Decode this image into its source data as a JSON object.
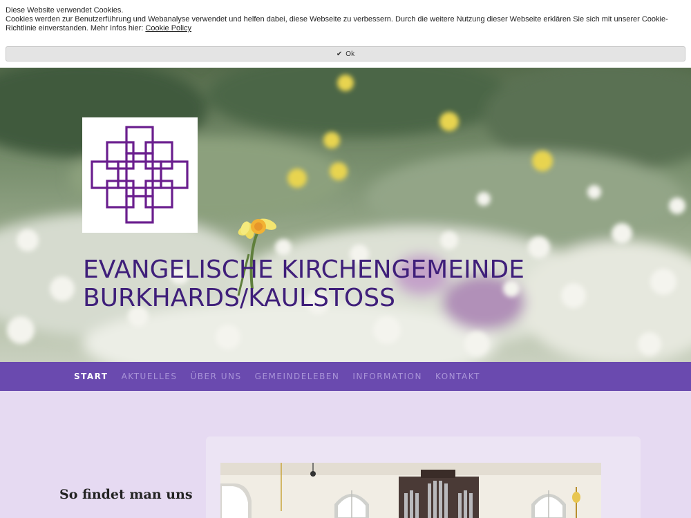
{
  "cookie": {
    "heading": "Diese Website verwendet Cookies.",
    "body": "Cookies werden zur Benutzerführung und Webanalyse verwendet und helfen dabei, diese Webseite zu verbessern. Durch die weitere Nutzung dieser Webseite erklären Sie sich mit unserer Cookie-Richtlinie einverstanden. Mehr Infos hier: ",
    "link_label": "Cookie Policy",
    "ok_label": "Ok",
    "ok_icon": "check-icon"
  },
  "header": {
    "title_line1": "Evangelische Kirchengemeinde",
    "title_line2": "Burkhards/Kaulstoss",
    "logo_icon": "cross-logo-icon",
    "logo_color": "#6a1e8e"
  },
  "nav": {
    "items": [
      {
        "label": "Start",
        "active": true
      },
      {
        "label": "Aktuelles"
      },
      {
        "label": "Über uns"
      },
      {
        "label": "Gemeindeleben"
      },
      {
        "label": "Information"
      },
      {
        "label": "Kontakt"
      }
    ]
  },
  "sidebar": {
    "title": "So findet man uns"
  },
  "colors": {
    "nav_bg": "#6a4aaf",
    "page_bg": "#e6daf2",
    "title": "#3f1f7a"
  }
}
